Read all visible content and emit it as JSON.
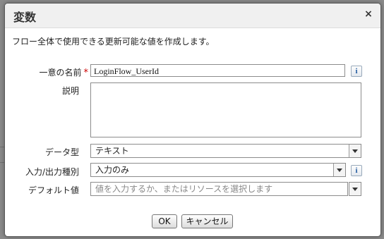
{
  "dialog": {
    "title": "変数",
    "close_symbol": "×",
    "description": "フロー全体で使用できる更新可能な値を作成します。"
  },
  "fields": {
    "unique_name": {
      "label": "一意の名前",
      "required_mark": "*",
      "value": "LoginFlow_UserId",
      "info_symbol": "i"
    },
    "description": {
      "label": "説明",
      "value": ""
    },
    "data_type": {
      "label": "データ型",
      "value": "テキスト"
    },
    "io_type": {
      "label": "入力/出力種別",
      "value": "入力のみ",
      "info_symbol": "i"
    },
    "default_value": {
      "label": "デフォルト値",
      "placeholder": "値を入力するか、またはリソースを選択します"
    }
  },
  "buttons": {
    "ok": "OK",
    "cancel": "キャンセル"
  },
  "colors": {
    "required": "#cc0000",
    "overlay": "#8a8a8a",
    "info_icon": "#1f5aa0"
  }
}
